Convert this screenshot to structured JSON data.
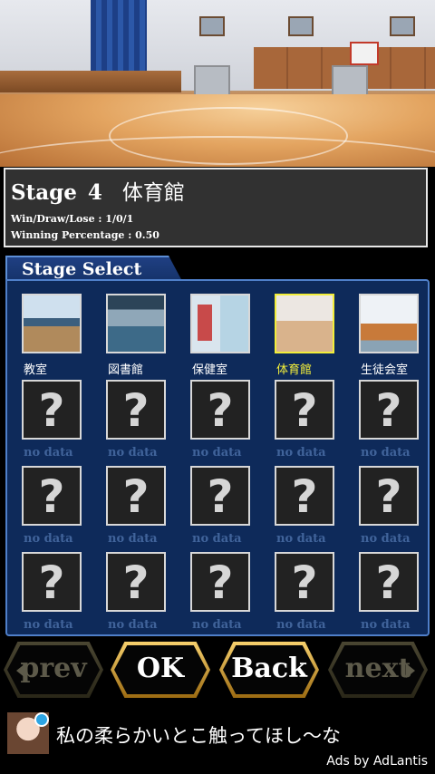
{
  "info": {
    "stage_word": "Stage",
    "stage_number": "4",
    "stage_name": "体育館",
    "win_draw_lose": "Win/Draw/Lose : 1/0/1",
    "winning_percentage": "Winning Percentage : 0.50"
  },
  "stage_select": {
    "title": "Stage Select",
    "stages": [
      {
        "label": "教室",
        "image": "classroom",
        "selected": false
      },
      {
        "label": "図書館",
        "image": "library",
        "selected": false
      },
      {
        "label": "保健室",
        "image": "health-room",
        "selected": false
      },
      {
        "label": "体育館",
        "image": "gymnasium",
        "selected": true
      },
      {
        "label": "生徒会室",
        "image": "student-council-room",
        "selected": false
      }
    ],
    "locked_symbol": "?",
    "locked_label": "no data"
  },
  "nav": {
    "prev": "prev",
    "ok": "OK",
    "back": "Back",
    "next": "next"
  },
  "ad": {
    "text": "私の柔らかいとこ触ってほし～な",
    "by": "Ads by AdLantis"
  },
  "colors": {
    "accent_gold": "#e3b447",
    "selected_yellow": "#f2ee3a",
    "board_blue": "#0e2a5a",
    "no_data_blue": "#40639a"
  }
}
